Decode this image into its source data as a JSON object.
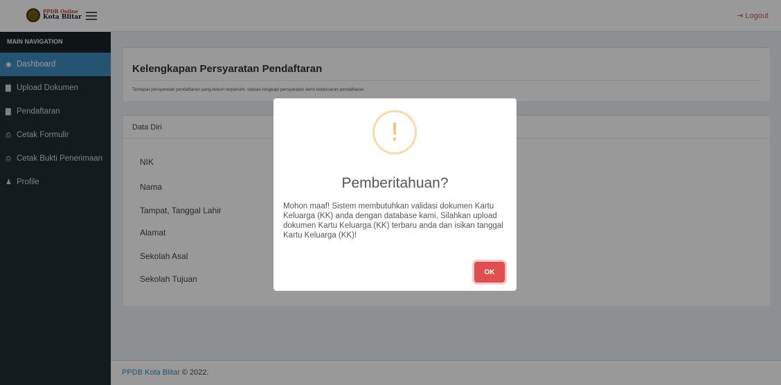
{
  "brand": {
    "line1": "PPDB Online",
    "line2": "Kota Blitar"
  },
  "topbar": {
    "logout_label": "Logout",
    "logout_icon": "sign-out-icon"
  },
  "sidebar": {
    "header": "MAIN NAVIGATION",
    "items": [
      {
        "icon": "dashboard-icon",
        "glyph": "◉",
        "label": "Dashboard",
        "active": true
      },
      {
        "icon": "file-icon",
        "glyph": "▇",
        "label": "Upload Dokumen"
      },
      {
        "icon": "file-icon",
        "glyph": "▇",
        "label": "Pendaftaran"
      },
      {
        "icon": "print-icon",
        "glyph": "⎙",
        "label": "Cetak Formulir"
      },
      {
        "icon": "print-icon",
        "glyph": "⎙",
        "label": "Cetak Bukti Penerimaan"
      },
      {
        "icon": "user-icon",
        "glyph": "♟",
        "label": "Profile"
      }
    ]
  },
  "requirements": {
    "title": "Kelengkapan Persyaratan Pendaftaran",
    "text": "Terdapat persyaratan pendaftaran yang belum terpenuhi. silakan lengkapi persyaratan demi kelancaran pendaftaran."
  },
  "datadiri": {
    "header": "Data Diri",
    "fields": [
      "NIK",
      "Nama",
      "Tampat, Tanggal Lahir",
      "Alamat",
      "Sekolah Asal",
      "Sekolah Tujuan"
    ]
  },
  "footer": {
    "link": "PPDB Kota Blitar",
    "suffix": "© 2022."
  },
  "modal": {
    "icon": "warning-icon",
    "title": "Pemberitahuan?",
    "message": "Mohon maaf! Sistem membutuhkan validasi dokumen Kartu Keluarga (KK) anda dengan database kami, Silahkan upload dokumen Kartu Keluarga (KK) terbaru anda dan isikan tanggal Kartu Keluarga (KK)!",
    "ok_label": "OK"
  },
  "colors": {
    "sidebar": "#222d32",
    "active": "#3c8dbc",
    "ok": "#e04f4f",
    "warning": "#f5bd78"
  }
}
